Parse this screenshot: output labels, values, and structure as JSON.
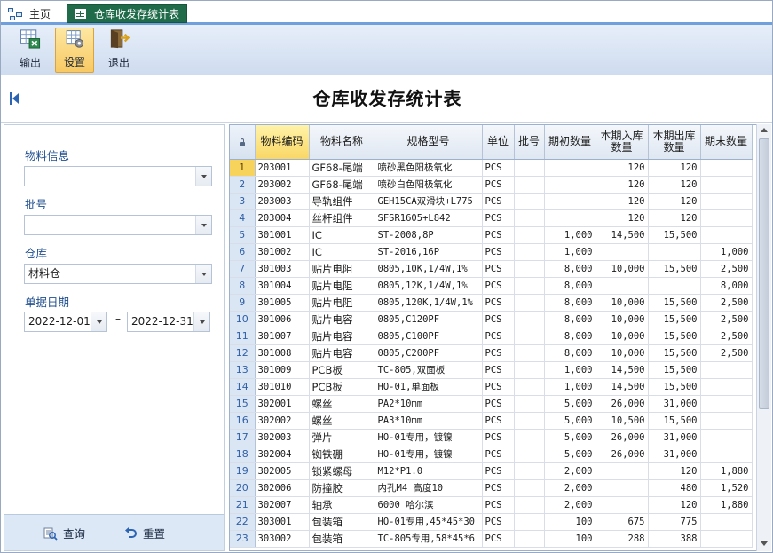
{
  "tabs": {
    "home": "主页",
    "active": "仓库收发存统计表"
  },
  "toolbar": {
    "export_label": "输出",
    "settings_label": "设置",
    "exit_label": "退出"
  },
  "page_title": "仓库收发存统计表",
  "filter": {
    "material_label": "物料信息",
    "material_value": "",
    "batch_label": "批号",
    "batch_value": "",
    "warehouse_label": "仓库",
    "warehouse_value": "材料仓",
    "date_label": "单据日期",
    "date_from": "2022-12-01",
    "date_sep": "–",
    "date_to": "2022-12-31",
    "query_label": "查询",
    "reset_label": "重置"
  },
  "grid": {
    "columns": [
      "物料编码",
      "物料名称",
      "规格型号",
      "单位",
      "批号",
      "期初数量",
      "本期入库数量",
      "本期出库数量",
      "期末数量"
    ],
    "selected_row": 1,
    "rows": [
      {
        "n": "1",
        "code": "203001",
        "name": "GF68-尾端",
        "spec": "喷砂黑色阳极氧化",
        "unit": "PCS",
        "batch": "",
        "open": "",
        "in": "120",
        "out": "120",
        "close": ""
      },
      {
        "n": "2",
        "code": "203002",
        "name": "GF68-尾端",
        "spec": "喷砂白色阳极氧化",
        "unit": "PCS",
        "batch": "",
        "open": "",
        "in": "120",
        "out": "120",
        "close": ""
      },
      {
        "n": "3",
        "code": "203003",
        "name": "导轨组件",
        "spec": "GEH15CA双滑块+L775",
        "unit": "PCS",
        "batch": "",
        "open": "",
        "in": "120",
        "out": "120",
        "close": ""
      },
      {
        "n": "4",
        "code": "203004",
        "name": "丝杆组件",
        "spec": "SFSR1605+L842",
        "unit": "PCS",
        "batch": "",
        "open": "",
        "in": "120",
        "out": "120",
        "close": ""
      },
      {
        "n": "5",
        "code": "301001",
        "name": "IC",
        "spec": "ST-2008,8P",
        "unit": "PCS",
        "batch": "",
        "open": "1,000",
        "in": "14,500",
        "out": "15,500",
        "close": ""
      },
      {
        "n": "6",
        "code": "301002",
        "name": "IC",
        "spec": "ST-2016,16P",
        "unit": "PCS",
        "batch": "",
        "open": "1,000",
        "in": "",
        "out": "",
        "close": "1,000"
      },
      {
        "n": "7",
        "code": "301003",
        "name": "贴片电阻",
        "spec": "0805,10K,1/4W,1%",
        "unit": "PCS",
        "batch": "",
        "open": "8,000",
        "in": "10,000",
        "out": "15,500",
        "close": "2,500"
      },
      {
        "n": "8",
        "code": "301004",
        "name": "贴片电阻",
        "spec": "0805,12K,1/4W,1%",
        "unit": "PCS",
        "batch": "",
        "open": "8,000",
        "in": "",
        "out": "",
        "close": "8,000"
      },
      {
        "n": "9",
        "code": "301005",
        "name": "贴片电阻",
        "spec": "0805,120K,1/4W,1%",
        "unit": "PCS",
        "batch": "",
        "open": "8,000",
        "in": "10,000",
        "out": "15,500",
        "close": "2,500"
      },
      {
        "n": "10",
        "code": "301006",
        "name": "贴片电容",
        "spec": "0805,C120PF",
        "unit": "PCS",
        "batch": "",
        "open": "8,000",
        "in": "10,000",
        "out": "15,500",
        "close": "2,500"
      },
      {
        "n": "11",
        "code": "301007",
        "name": "贴片电容",
        "spec": "0805,C100PF",
        "unit": "PCS",
        "batch": "",
        "open": "8,000",
        "in": "10,000",
        "out": "15,500",
        "close": "2,500"
      },
      {
        "n": "12",
        "code": "301008",
        "name": "贴片电容",
        "spec": "0805,C200PF",
        "unit": "PCS",
        "batch": "",
        "open": "8,000",
        "in": "10,000",
        "out": "15,500",
        "close": "2,500"
      },
      {
        "n": "13",
        "code": "301009",
        "name": "PCB板",
        "spec": "TC-805,双面板",
        "unit": "PCS",
        "batch": "",
        "open": "1,000",
        "in": "14,500",
        "out": "15,500",
        "close": ""
      },
      {
        "n": "14",
        "code": "301010",
        "name": "PCB板",
        "spec": "HO-01,单面板",
        "unit": "PCS",
        "batch": "",
        "open": "1,000",
        "in": "14,500",
        "out": "15,500",
        "close": ""
      },
      {
        "n": "15",
        "code": "302001",
        "name": "螺丝",
        "spec": "PA2*10mm",
        "unit": "PCS",
        "batch": "",
        "open": "5,000",
        "in": "26,000",
        "out": "31,000",
        "close": ""
      },
      {
        "n": "16",
        "code": "302002",
        "name": "螺丝",
        "spec": "PA3*10mm",
        "unit": "PCS",
        "batch": "",
        "open": "5,000",
        "in": "10,500",
        "out": "15,500",
        "close": ""
      },
      {
        "n": "17",
        "code": "302003",
        "name": "弹片",
        "spec": "HO-01专用，镀镍",
        "unit": "PCS",
        "batch": "",
        "open": "5,000",
        "in": "26,000",
        "out": "31,000",
        "close": ""
      },
      {
        "n": "18",
        "code": "302004",
        "name": "铷铁硼",
        "spec": "HO-01专用，镀镍",
        "unit": "PCS",
        "batch": "",
        "open": "5,000",
        "in": "26,000",
        "out": "31,000",
        "close": ""
      },
      {
        "n": "19",
        "code": "302005",
        "name": "锁紧螺母",
        "spec": "M12*P1.0",
        "unit": "PCS",
        "batch": "",
        "open": "2,000",
        "in": "",
        "out": "120",
        "close": "1,880"
      },
      {
        "n": "20",
        "code": "302006",
        "name": "防撞胶",
        "spec": "内孔M4 高度10",
        "unit": "PCS",
        "batch": "",
        "open": "2,000",
        "in": "",
        "out": "480",
        "close": "1,520"
      },
      {
        "n": "21",
        "code": "302007",
        "name": "轴承",
        "spec": "6000 哈尔滨",
        "unit": "PCS",
        "batch": "",
        "open": "2,000",
        "in": "",
        "out": "120",
        "close": "1,880"
      },
      {
        "n": "22",
        "code": "303001",
        "name": "包装箱",
        "spec": "HO-01专用,45*45*30",
        "unit": "PCS",
        "batch": "",
        "open": "100",
        "in": "675",
        "out": "775",
        "close": ""
      },
      {
        "n": "23",
        "code": "303002",
        "name": "包装箱",
        "spec": "TC-805专用,58*45*6",
        "unit": "PCS",
        "batch": "",
        "open": "100",
        "in": "288",
        "out": "388",
        "close": ""
      }
    ]
  },
  "icons": {
    "home": "home-tree-icon",
    "tab": "grid-icon",
    "export": "export-excel-icon",
    "settings": "settings-grid-icon",
    "exit": "exit-door-icon",
    "collapse": "collapse-left-icon",
    "query": "search-icon",
    "reset": "undo-icon"
  },
  "colors": {
    "accent": "#1f6b4a",
    "ribbon": "#d6e3f3",
    "selected": "#f8d35c"
  }
}
